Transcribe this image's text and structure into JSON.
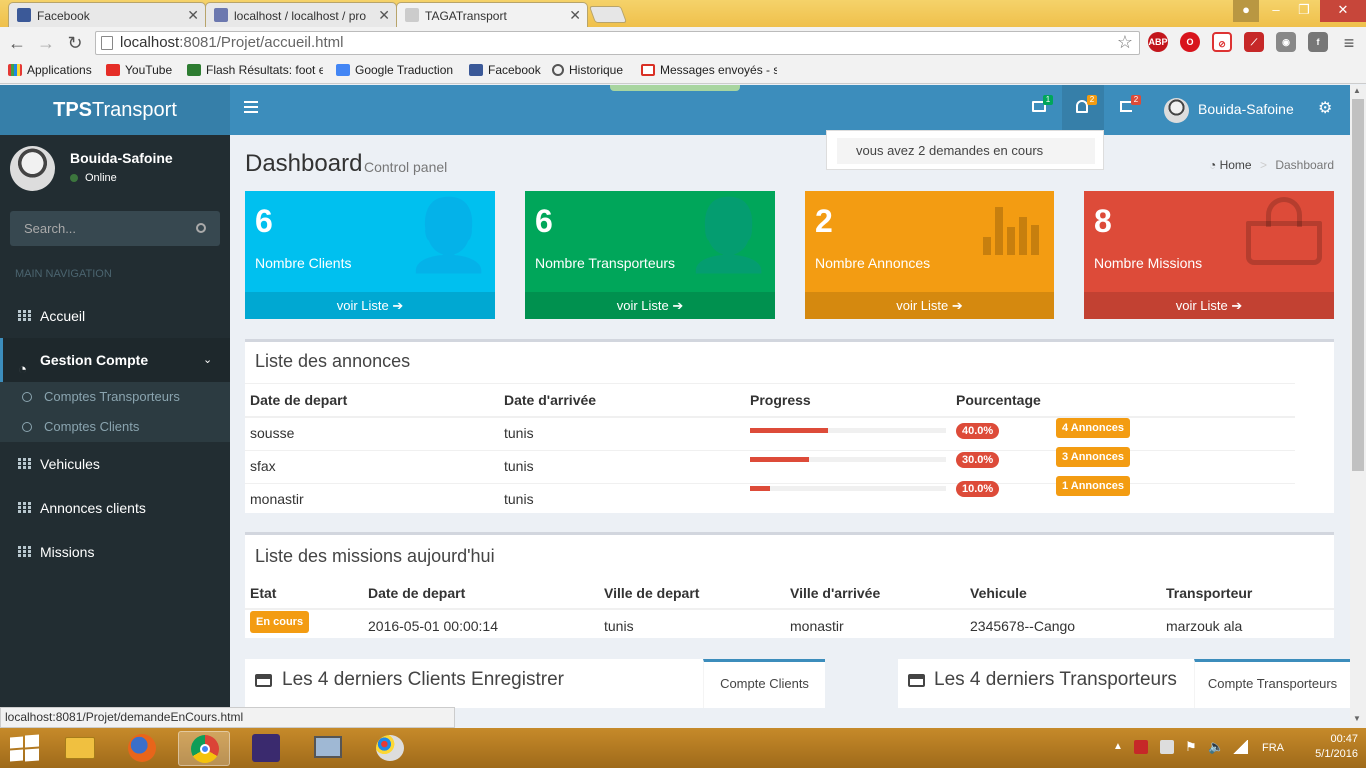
{
  "browser": {
    "tabs": [
      {
        "title": "Facebook",
        "favicon_color": "#3b5998"
      },
      {
        "title": "localhost / localhost / pro",
        "favicon_color": "#6c78af"
      },
      {
        "title": "TAGATransport",
        "favicon_color": "#cccccc"
      }
    ],
    "url_host": "localhost",
    "url_rest": ":8081/Projet/accueil.html",
    "bookmarks": [
      {
        "label": "Applications",
        "icon": "apps-icon"
      },
      {
        "label": "YouTube",
        "icon": "youtube-icon"
      },
      {
        "label": "Flash Résultats: foot e",
        "icon": "flash-icon"
      },
      {
        "label": "Google Traduction",
        "icon": "translate-icon"
      },
      {
        "label": "Facebook",
        "icon": "facebook-icon"
      },
      {
        "label": "Historique",
        "icon": "history-icon"
      },
      {
        "label": "Messages envoyés - s",
        "icon": "gmail-icon"
      }
    ],
    "status_url": "localhost:8081/Projet/demandeEnCours.html",
    "extensions": [
      "ABP"
    ]
  },
  "app": {
    "logo_bold": "TPS",
    "logo_rest": "Transport",
    "user": {
      "name": "Bouida-Safoine",
      "status": "Online"
    },
    "header_counts": {
      "mail": "1",
      "bell": "2",
      "flag": "2"
    },
    "notification_text": "vous avez 2 demandes en cours",
    "search_placeholder": "Search...",
    "nav_header": "MAIN NAVIGATION",
    "nav": {
      "accueil": "Accueil",
      "gestion": "Gestion Compte",
      "sub1": "Comptes Transporteurs",
      "sub2": "Comptes Clients",
      "vehicules": "Vehicules",
      "annonces": "Annonces clients",
      "missions": "Missions"
    },
    "page_title": "Dashboard",
    "page_subtitle": "Control panel",
    "breadcrumb": {
      "home": "Home",
      "sep": ">",
      "current": "Dashboard"
    },
    "stat_boxes": [
      {
        "value": "6",
        "label": "Nombre Clients",
        "link": "voir Liste",
        "color": "#00c0ef"
      },
      {
        "value": "6",
        "label": "Nombre Transporteurs",
        "link": "voir Liste",
        "color": "#00a65a"
      },
      {
        "value": "2",
        "label": "Nombre Annonces",
        "link": "voir Liste",
        "color": "#f39c12"
      },
      {
        "value": "8",
        "label": "Nombre Missions",
        "link": "voir Liste",
        "color": "#dd4b39"
      }
    ],
    "annonces": {
      "title": "Liste des annonces",
      "headers": [
        "Date de depart",
        "Date d'arrivée",
        "Progress",
        "Pourcentage"
      ],
      "rows": [
        {
          "depart": "sousse",
          "arrivee": "tunis",
          "progress": 0.4,
          "pct": "40.0%",
          "badge": "4 Annonces"
        },
        {
          "depart": "sfax",
          "arrivee": "tunis",
          "progress": 0.3,
          "pct": "30.0%",
          "badge": "3 Annonces"
        },
        {
          "depart": "monastir",
          "arrivee": "tunis",
          "progress": 0.1,
          "pct": "10.0%",
          "badge": "1 Annonces"
        }
      ]
    },
    "missions": {
      "title": "Liste des missions aujourd'hui",
      "headers": [
        "Etat",
        "Date de depart",
        "Ville de depart",
        "Ville d'arrivée",
        "Vehicule",
        "Transporteur"
      ],
      "rows": [
        {
          "etat": "En cours",
          "date": "2016-05-01 00:00:14",
          "ville_dep": "tunis",
          "ville_arr": "monastir",
          "vehicule": "2345678--Cango",
          "transporteur": "marzouk ala"
        }
      ]
    },
    "clients_panel": {
      "title": "Les 4 derniers Clients Enregistrer",
      "tab": "Compte Clients"
    },
    "transp_panel": {
      "title": "Les 4 derniers Transporteurs",
      "tab": "Compte Transporteurs"
    }
  },
  "taskbar": {
    "lang": "FRA",
    "time": "00:47",
    "date": "5/1/2016"
  }
}
